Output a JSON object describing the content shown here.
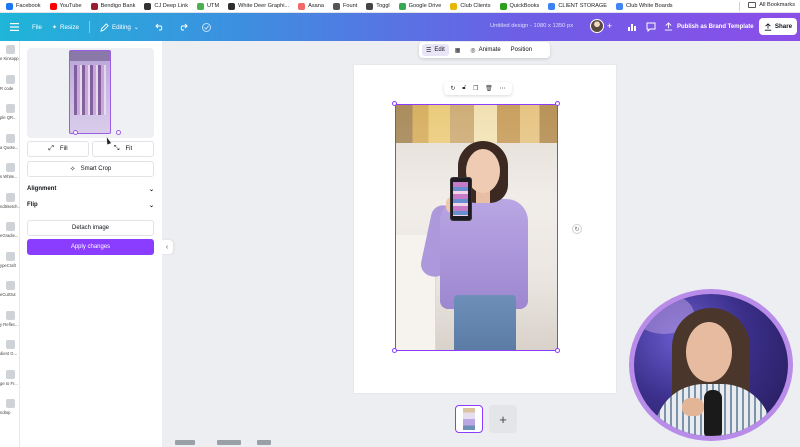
{
  "bookmarks": [
    {
      "label": "Facebook",
      "color": "#1877f2"
    },
    {
      "label": "YouTube",
      "color": "#ff0000"
    },
    {
      "label": "Bendigo Bank",
      "color": "#9b1c2e"
    },
    {
      "label": "CJ Deep Link",
      "color": "#333333"
    },
    {
      "label": "UTM",
      "color": "#4caf50"
    },
    {
      "label": "White Deer Graphi...",
      "color": "#2e2e2e"
    },
    {
      "label": "Asana",
      "color": "#f06a6a"
    },
    {
      "label": "Fount",
      "color": "#555555"
    },
    {
      "label": "Toggl",
      "color": "#444444"
    },
    {
      "label": "Google Drive",
      "color": "#34a853"
    },
    {
      "label": "Club Clients",
      "color": "#e6b800"
    },
    {
      "label": "QuickBooks",
      "color": "#2ca01c"
    },
    {
      "label": "CLIENT STORAGE",
      "color": "#3b82f6"
    },
    {
      "label": "Club White Boards",
      "color": "#4285f4"
    }
  ],
  "bookmarks_all": "All Bookmarks",
  "toolbar": {
    "file_label": "File",
    "resize_label": "Resize",
    "editing_label": "Editing",
    "design_title": "Untitled design - 1080 x 1350 px",
    "publish_label": "Publish as Brand Template",
    "share_label": "Share"
  },
  "rail_apps": [
    {
      "label": "e Kinsopp"
    },
    {
      "label": "R code"
    },
    {
      "label": "ple QR..."
    },
    {
      "label": "a Quote..."
    },
    {
      "label": "s White..."
    },
    {
      "label": "ndSketch..."
    },
    {
      "label": "eGradie..."
    },
    {
      "label": "ypeCraft"
    },
    {
      "label": "eCutOut"
    },
    {
      "label": "y Reflec..."
    },
    {
      "label": "dient G..."
    },
    {
      "label": "ge to Fr..."
    },
    {
      "label": "ndtop"
    }
  ],
  "panel": {
    "fill_label": "Fill",
    "fit_label": "Fit",
    "smart_crop_label": "Smart Crop",
    "alignment_label": "Alignment",
    "flip_label": "Flip",
    "detach_label": "Detach image",
    "apply_label": "Apply changes"
  },
  "context_toolbar": {
    "edit_label": "Edit",
    "animate_label": "Animate",
    "position_label": "Position"
  },
  "accent_color": "#8b3dff"
}
